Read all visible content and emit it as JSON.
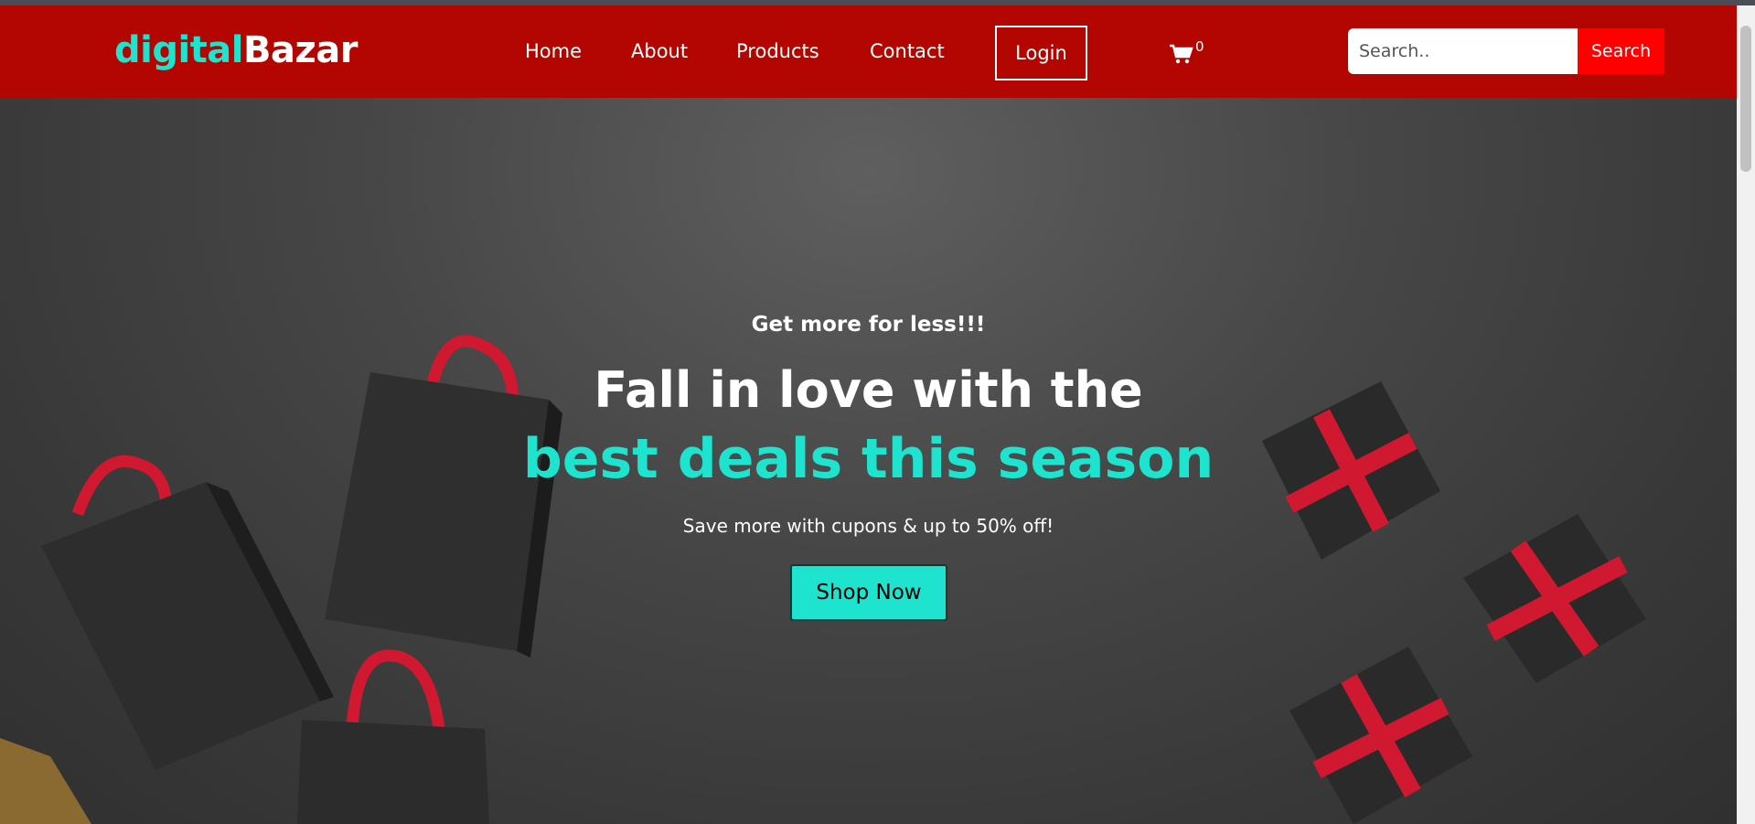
{
  "brand": {
    "part1": "digital",
    "part2": "Bazar"
  },
  "nav": {
    "home": "Home",
    "about": "About",
    "products": "Products",
    "contact": "Contact",
    "login": "Login",
    "cart_count": "0"
  },
  "search": {
    "placeholder": "Search..",
    "button": "Search"
  },
  "hero": {
    "tagline": "Get more for less!!!",
    "headline_line1": "Fall in love with the",
    "headline_line2": "best deals this season",
    "subtext": "Save more with cupons & up to 50% off!",
    "cta": "Shop Now"
  },
  "colors": {
    "nav_bg": "#b30600",
    "accent": "#1ee3cf",
    "search_button": "#ff0000",
    "ribbon": "#d01830"
  },
  "icons": {
    "cart": "shopping-cart-icon"
  }
}
